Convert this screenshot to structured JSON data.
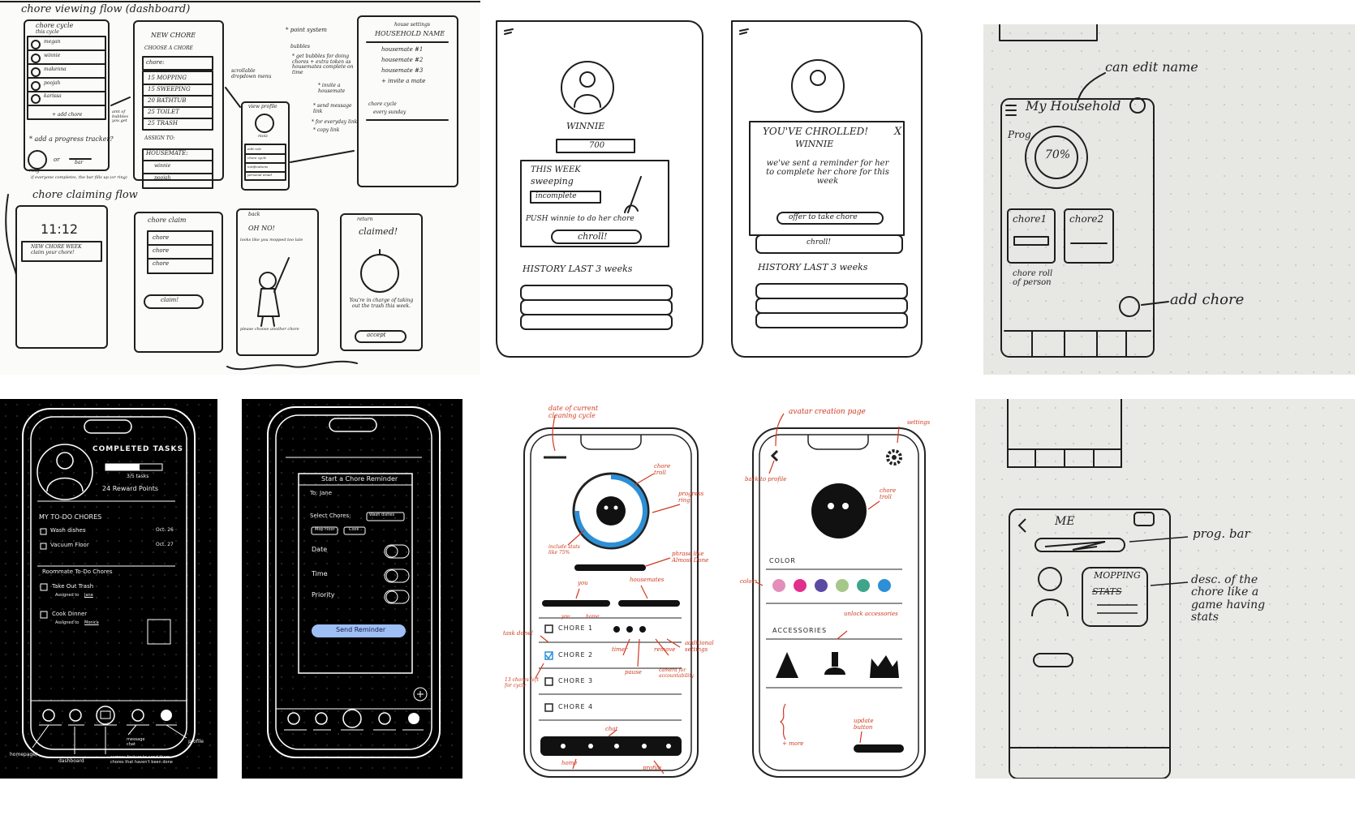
{
  "panel1": {
    "title": "chore viewing flow (dashboard)",
    "chore_cycle": "chore cycle",
    "this_cycle": "this cycle",
    "rows": [
      "megan",
      "winnie",
      "makenna",
      "poojah",
      "karissa"
    ],
    "add_chore": "+ add chore",
    "new_chore": "NEW CHORE",
    "choose_chore": "CHOOSE A CHORE",
    "chore_field": "chore:",
    "chore_options": [
      "15 MOPPING",
      "15 SWEEPING",
      "20 BATHTUB",
      "25 TOILET",
      "25 TRASH"
    ],
    "assign_to": "ASSIGN TO:",
    "housemate": "HOUSEMATE:",
    "housemates": [
      "winnie",
      "poojah"
    ],
    "scrollable": "scrollable dropdown menu",
    "amt_bubbles": "amt of bubbles you get",
    "add_progress": "* add a progress tracker?",
    "ring": "ring",
    "or": "or",
    "bar": "bar",
    "note_bottom": "if everyone completes, the bar fills up (or ring)",
    "view_profile": "view profile",
    "profile_name": "moiz",
    "profile_items": [
      "edit role",
      "chore cycle",
      "notifications",
      "personal email"
    ],
    "notes": [
      "* point system",
      "bubbles",
      "* get bubbles for doing chores + extra token as housemates complete on time",
      "* invite a housemate",
      "* send message link",
      "* for everyday link",
      "* copy link"
    ],
    "house_settings": "house settings",
    "household_name": "HOUSEHOLD NAME",
    "house_list": [
      "housemate #1",
      "housemate #2",
      "housemate #3",
      "+ invite a mate"
    ],
    "cycle_label": "chore cycle",
    "cycle_value": "every sunday",
    "claim_title": "chore claiming flow",
    "time": "11:12",
    "notif": "NEW CHORE WEEK claim your chore!",
    "chore_claim": "chore claim",
    "claim_items": [
      "chore",
      "chore",
      "chore"
    ],
    "claim_btn": "claim!",
    "back": "back",
    "oh_no": "OH NO!",
    "oh_no_sub": "looks like you mopped too late",
    "choose_another": "please choose another chore",
    "return": "return",
    "claimed": "claimed!",
    "in_charge": "You're in charge of taking out the trash this week.",
    "accept": "accept"
  },
  "panel2": {
    "name": "WINNIE",
    "points": "700",
    "this_week": "THIS WEEK",
    "chore": "sweeping",
    "status": "incomplete",
    "push": "PUSH winnie to do her chore",
    "chroll": "chroll!",
    "history": "HISTORY LAST 3 weeks"
  },
  "panel3": {
    "title": "YOU'VE CHROLLED!",
    "name": "WINNIE",
    "close": "X",
    "msg": "we've sent a reminder for her to complete her chore for this week",
    "offer": "offer to take chore",
    "chroll": "chroll!",
    "history": "HISTORY LAST 3 weeks"
  },
  "panel4": {
    "can_edit": "can edit name",
    "household": "My Household",
    "prog": "Prog",
    "percent": "70%",
    "chore1": "chore1",
    "chore2": "chore2",
    "chore_roll": "chore roll of person",
    "add_chore": "add chore"
  },
  "panel5": {
    "completed": "COMPLETED TASKS",
    "count": "3/5 tasks",
    "reward": "24 Reward Points",
    "my_todo": "MY TO-DO CHORES",
    "todo": [
      {
        "label": "Wash dishes",
        "date": "Oct. 26"
      },
      {
        "label": "Vacuum Floor",
        "date": "Oct. 27"
      }
    ],
    "roommate": "Roommate To-Do Chores",
    "rm": [
      {
        "label": "Take Out Trash",
        "assigned": "Assigned to",
        "who": "Jane"
      },
      {
        "label": "Cook Dinner",
        "assigned": "Assigned to",
        "who": "Monica"
      }
    ],
    "annotations": [
      "homepage/",
      "dashboard",
      "camera feature to send them chores that haven't been done",
      "message chat",
      "profile"
    ]
  },
  "panel6": {
    "title": "Start a Chore Reminder",
    "to": "To: Jane",
    "select": "Select Chores:",
    "chip1": "Wash dishes",
    "chip2": "Mop Floor",
    "chip3": "Cook",
    "date": "Date",
    "time": "Time",
    "priority": "Priority",
    "send": "Send Reminder"
  },
  "panel7": {
    "annotations": [
      "date of current cleaning cycle",
      "chore troll",
      "progress ring",
      "include stats like 75%",
      "phrase like Almost Done",
      "you",
      "housemates",
      "task done!",
      "you",
      "home",
      "timer",
      "remove",
      "additional settings",
      "pause",
      "camera for accountability",
      "13 chores left for cycle",
      "chat",
      "home",
      "profile"
    ],
    "chores": [
      "CHORE 1",
      "CHORE 2",
      "CHORE 3",
      "CHORE 4"
    ]
  },
  "panel8": {
    "annotations": [
      "avatar creation page",
      "settings",
      "back to profile",
      "chore troll",
      "colors",
      "unlock accessories",
      "+ more",
      "update button"
    ],
    "color": "COLOR",
    "accessories": "ACCESSORIES",
    "swatches": [
      "#e38fba",
      "#e12f8c",
      "#5a4aa3",
      "#a5c78a",
      "#3ea58a",
      "#2d8fd5"
    ]
  },
  "panel9": {
    "me": "ME",
    "prog_bar": "prog. bar",
    "mopping": "MOPPING",
    "stats": "STATS",
    "desc": "desc. of the chore like a game having stats"
  }
}
